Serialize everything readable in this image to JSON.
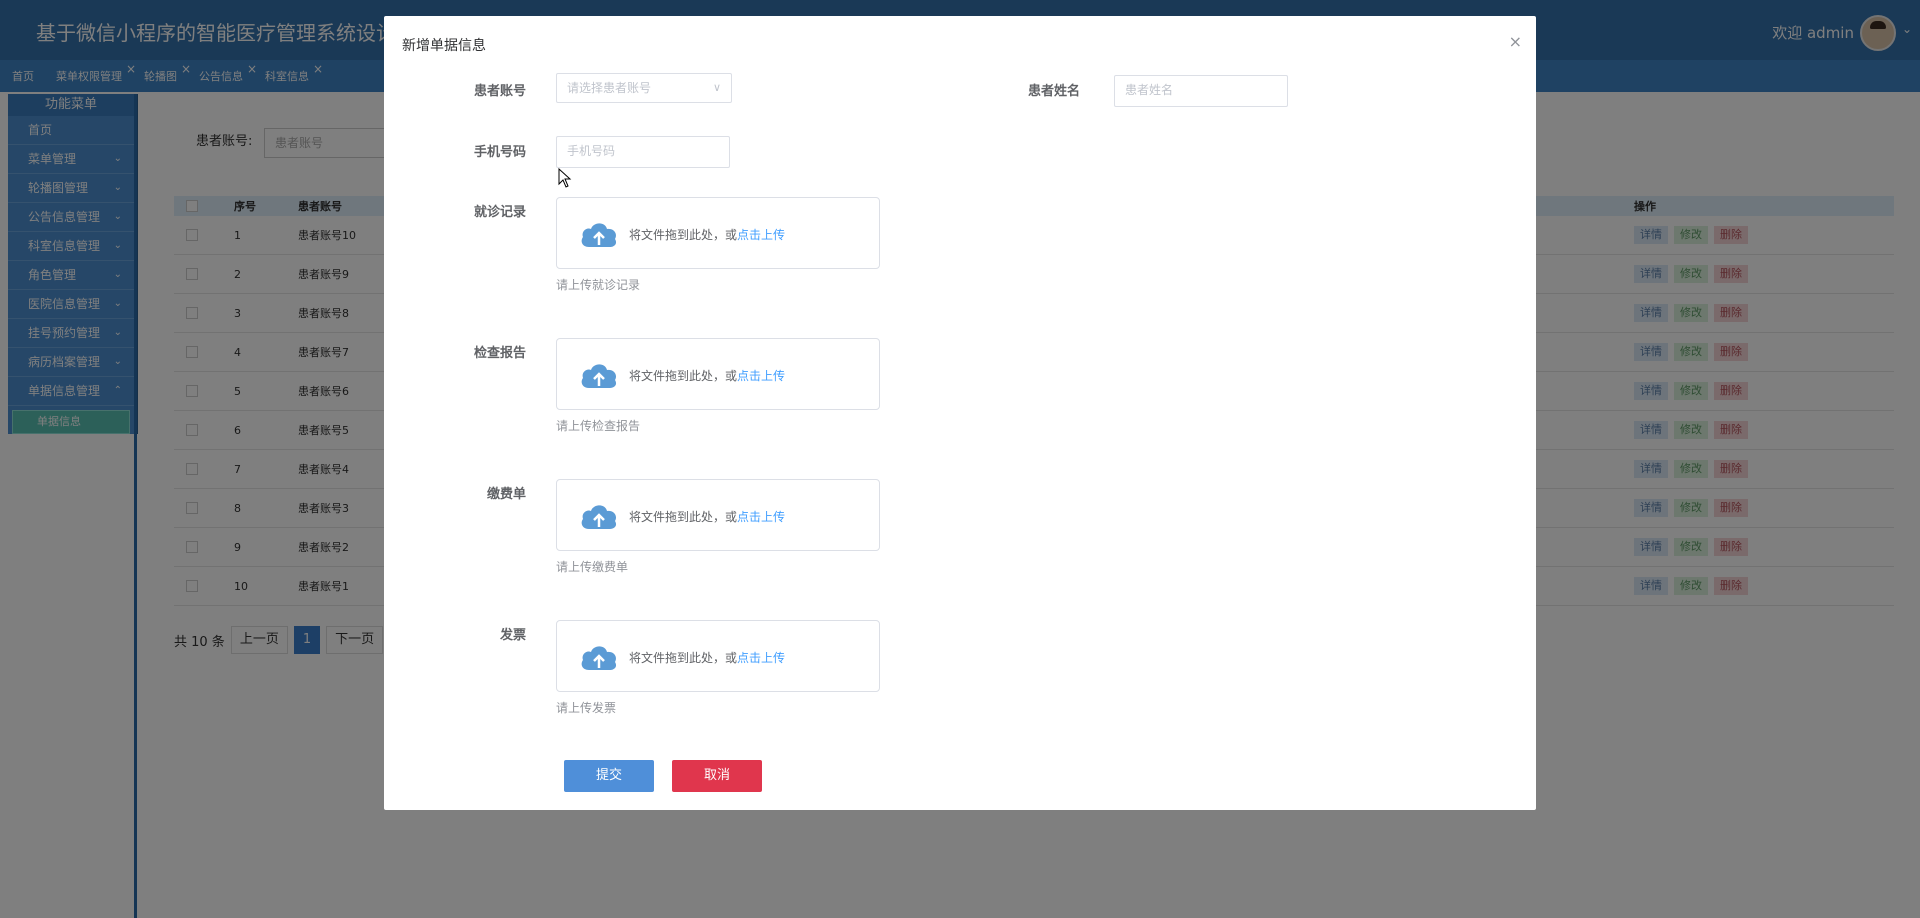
{
  "header": {
    "app_title": "基于微信小程序的智能医疗管理系统设计与",
    "welcome": "欢迎 admin"
  },
  "tabs": [
    {
      "label": "首页",
      "closable": false
    },
    {
      "label": "菜单权限管理",
      "closable": true
    },
    {
      "label": "轮播图",
      "closable": true
    },
    {
      "label": "公告信息",
      "closable": true
    },
    {
      "label": "科室信息",
      "closable": true
    }
  ],
  "sidebar": {
    "heading": "功能菜单",
    "items": [
      {
        "label": "首页",
        "has_chevron": false
      },
      {
        "label": "菜单管理",
        "has_chevron": true
      },
      {
        "label": "轮播图管理",
        "has_chevron": true
      },
      {
        "label": "公告信息管理",
        "has_chevron": true
      },
      {
        "label": "科室信息管理",
        "has_chevron": true
      },
      {
        "label": "角色管理",
        "has_chevron": true
      },
      {
        "label": "医院信息管理",
        "has_chevron": true
      },
      {
        "label": "挂号预约管理",
        "has_chevron": true
      },
      {
        "label": "病历档案管理",
        "has_chevron": true
      },
      {
        "label": "单据信息管理",
        "has_chevron": true,
        "expanded": true
      }
    ],
    "active_sub": "单据信息"
  },
  "search": {
    "label": "患者账号:",
    "placeholder": "患者账号"
  },
  "table": {
    "columns": [
      "序号",
      "患者账号",
      "操作"
    ],
    "rows": [
      {
        "no": "1",
        "account": "患者账号10"
      },
      {
        "no": "2",
        "account": "患者账号9"
      },
      {
        "no": "3",
        "account": "患者账号8"
      },
      {
        "no": "4",
        "account": "患者账号7"
      },
      {
        "no": "5",
        "account": "患者账号6"
      },
      {
        "no": "6",
        "account": "患者账号5"
      },
      {
        "no": "7",
        "account": "患者账号4"
      },
      {
        "no": "8",
        "account": "患者账号3"
      },
      {
        "no": "9",
        "account": "患者账号2"
      },
      {
        "no": "10",
        "account": "患者账号1"
      }
    ],
    "actions": {
      "detail": "详情",
      "edit": "修改",
      "delete": "删除"
    }
  },
  "pager": {
    "total": "共 10 条",
    "prev": "上一页",
    "current": "1",
    "next": "下一页"
  },
  "modal": {
    "title": "新增单据信息",
    "close_glyph": "×",
    "fields": {
      "account_label": "患者账号",
      "account_placeholder": "请选择患者账号",
      "name_label": "患者姓名",
      "name_placeholder": "患者姓名",
      "phone_label": "手机号码",
      "phone_placeholder": "手机号码"
    },
    "uploads": [
      {
        "label": "就诊记录",
        "drag_text": "将文件拖到此处，或",
        "link_text": "点击上传",
        "tip": "请上传就诊记录"
      },
      {
        "label": "检查报告",
        "drag_text": "将文件拖到此处，或",
        "link_text": "点击上传",
        "tip": "请上传检查报告"
      },
      {
        "label": "缴费单",
        "drag_text": "将文件拖到此处，或",
        "link_text": "点击上传",
        "tip": "请上传缴费单"
      },
      {
        "label": "发票",
        "drag_text": "将文件拖到此处，或",
        "link_text": "点击上传",
        "tip": "请上传发票"
      }
    ],
    "submit_label": "提交",
    "cancel_label": "取消"
  },
  "colors": {
    "topbar": "#3573ac",
    "tabbar": "#3e84c6",
    "submit": "#4f8fd9",
    "cancel": "#e0364d",
    "link": "#409eff"
  }
}
